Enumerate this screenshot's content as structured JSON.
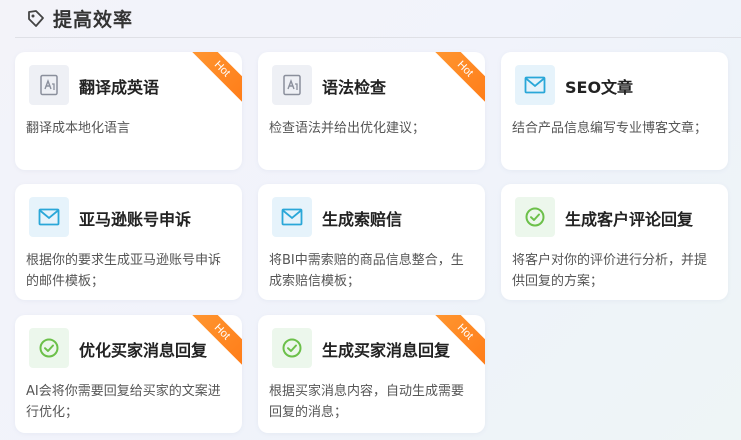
{
  "section": {
    "title": "提高效率",
    "icon": "tag-icon"
  },
  "cards": [
    {
      "title": "翻译成英语",
      "desc": "翻译成本地化语言",
      "icon": "document-a-icon",
      "badge": "Hot"
    },
    {
      "title": "语法检查",
      "desc": "检查语法并给出优化建议；",
      "icon": "document-a-icon",
      "badge": "Hot"
    },
    {
      "title": "SEO文章",
      "desc": "结合产品信息编写专业博客文章；",
      "icon": "mail-icon",
      "badge": ""
    },
    {
      "title": "亚马逊账号申诉",
      "desc": "根据你的要求生成亚马逊账号申诉的邮件模板；",
      "icon": "mail-icon",
      "badge": ""
    },
    {
      "title": "生成索赔信",
      "desc": "将BI中需索赔的商品信息整合，生成索赔信模板；",
      "icon": "mail-icon",
      "badge": ""
    },
    {
      "title": "生成客户评论回复",
      "desc": "将客户对你的评价进行分析，并提供回复的方案；",
      "icon": "check-circle-icon",
      "badge": ""
    },
    {
      "title": "优化买家消息回复",
      "desc": "AI会将你需要回复给买家的文案进行优化；",
      "icon": "check-circle-icon",
      "badge": "Hot"
    },
    {
      "title": "生成买家消息回复",
      "desc": "根据买家消息内容，自动生成需要回复的消息；",
      "icon": "check-circle-icon",
      "badge": "Hot"
    }
  ],
  "colors": {
    "hot": "#ff8a25",
    "mail": "#2aa7d8",
    "check": "#6cc04a",
    "doc": "#8a8f9c"
  }
}
